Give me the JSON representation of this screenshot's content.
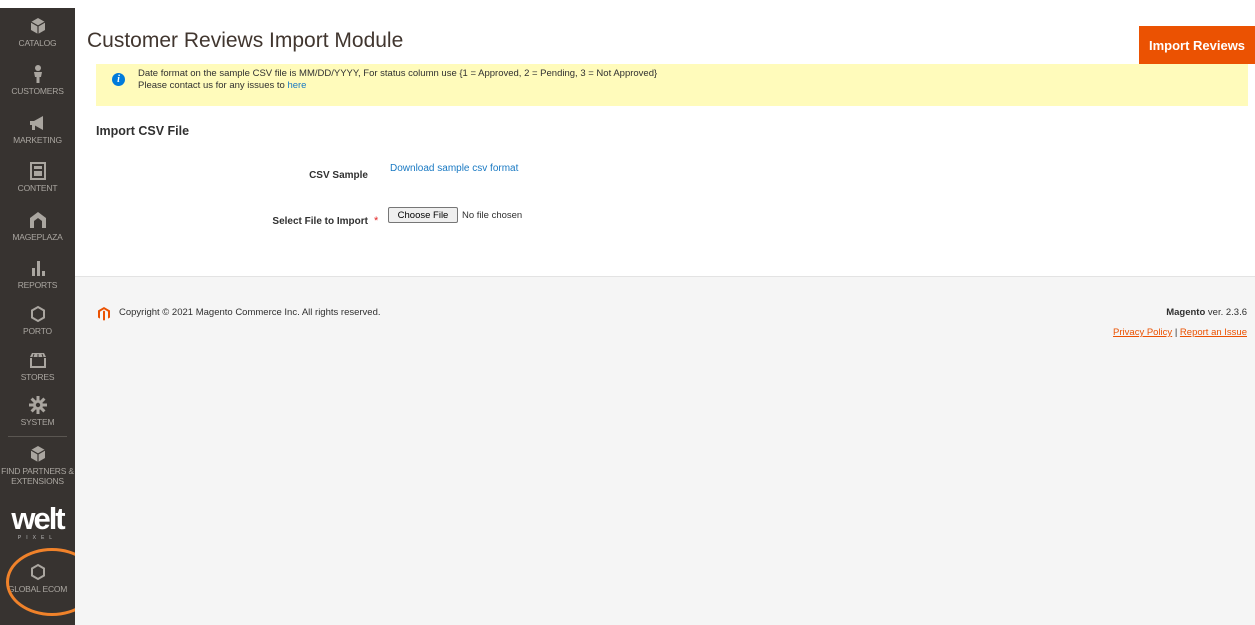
{
  "sidebar": {
    "items": [
      {
        "label": "CATALOG",
        "icon": "cube-icon"
      },
      {
        "label": "CUSTOMERS",
        "icon": "person-icon"
      },
      {
        "label": "MARKETING",
        "icon": "megaphone-icon"
      },
      {
        "label": "CONTENT",
        "icon": "layout-icon"
      },
      {
        "label": "MAGEPLAZA",
        "icon": "mageplaza-logo-icon"
      },
      {
        "label": "REPORTS",
        "icon": "bar-chart-icon"
      },
      {
        "label": "PORTO",
        "icon": "hexagon-icon"
      },
      {
        "label": "STORES",
        "icon": "storefront-icon"
      },
      {
        "label": "SYSTEM",
        "icon": "gear-icon"
      },
      {
        "label": "FIND PARTNERS & EXTENSIONS",
        "icon": "box-icon"
      },
      {
        "label": "GLOBAL ECOM",
        "icon": "hexagon-icon"
      }
    ],
    "brand_logo": {
      "word": "welt",
      "sub": "PIXEL"
    }
  },
  "header": {
    "title": "Customer Reviews Import Module",
    "import_button": "Import Reviews"
  },
  "notice": {
    "line1": "Date format on the sample CSV file is MM/DD/YYYY, For status column use {1 = Approved, 2 = Pending, 3 = Not Approved}",
    "line2_prefix": "Please contact us for any issues to",
    "line2_link": "here"
  },
  "form": {
    "section_title": "Import CSV File",
    "csv_sample_label": "CSV Sample",
    "csv_sample_link": "Download sample csv format",
    "file_label": "Select File to Import",
    "required_mark": "*",
    "choose_file_button": "Choose File",
    "file_status": "No file chosen"
  },
  "footer": {
    "copyright": "Copyright © 2021 Magento Commerce Inc. All rights reserved.",
    "brand": "Magento",
    "version": "ver. 2.3.6",
    "privacy": "Privacy Policy",
    "separator": "|",
    "report": "Report an Issue"
  },
  "colors": {
    "sidebar_bg": "#373330",
    "accent": "#eb5202",
    "notice_bg": "#fffbbb",
    "link": "#1979c3",
    "highlight": "#f0822a"
  }
}
